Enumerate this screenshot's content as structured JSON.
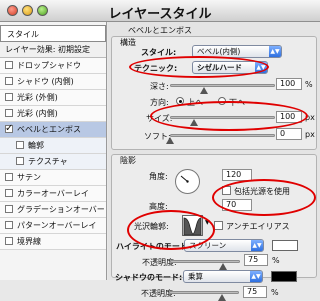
{
  "window": {
    "title": "レイヤースタイル"
  },
  "left_panel": {
    "header": "スタイル",
    "blend_options": "レイヤー効果: 初期設定",
    "items": [
      {
        "label": "ドロップシャドウ",
        "checked": false
      },
      {
        "label": "シャドウ (内側)",
        "checked": false
      },
      {
        "label": "光彩 (外側)",
        "checked": false
      },
      {
        "label": "光彩 (内側)",
        "checked": false
      },
      {
        "label": "ベベルとエンボス",
        "checked": true,
        "selected": true
      },
      {
        "label": "輪郭",
        "checked": false,
        "sub": true
      },
      {
        "label": "テクスチャ",
        "checked": false,
        "sub": true
      },
      {
        "label": "サテン",
        "checked": false
      },
      {
        "label": "カラーオーバーレイ",
        "checked": false
      },
      {
        "label": "グラデーションオーバーレイ",
        "checked": false
      },
      {
        "label": "パターンオーバーレイ",
        "checked": false
      },
      {
        "label": "境界線",
        "checked": false
      }
    ]
  },
  "bevel_emboss": {
    "group_title": "ベベルとエンボス",
    "structure_title": "構造",
    "style_label": "スタイル:",
    "style_value": "ベベル(内側)",
    "technique_label": "テクニック:",
    "technique_value": "シゼルハード",
    "depth_label": "深さ:",
    "depth_value": "100",
    "direction_label": "方向:",
    "direction_up": "上へ",
    "direction_down": "下へ",
    "size_label": "サイズ:",
    "size_value": "100",
    "size_unit": "px",
    "soften_label": "ソフト:",
    "soften_value": "0",
    "soften_unit": "px",
    "percent_unit": "%"
  },
  "shading": {
    "title": "陰影",
    "angle_label": "角度:",
    "angle_value": "120",
    "use_global_light": "包括光源を使用",
    "altitude_label": "高度:",
    "altitude_value": "70",
    "gloss_contour_label": "光沢輪郭:",
    "anti_aliased": "アンチエイリアス",
    "highlight_mode_label": "ハイライトのモード:",
    "highlight_mode_value": "スクリーン",
    "highlight_opacity_label": "不透明度:",
    "highlight_opacity_value": "75",
    "highlight_color": "#ffffff",
    "shadow_mode_label": "シャドウのモード:",
    "shadow_mode_value": "乗算",
    "shadow_opacity_label": "不透明度:",
    "shadow_opacity_value": "75",
    "shadow_color": "#000000",
    "percent_unit": "%"
  },
  "colors": {
    "highlight_ellipse": "#e00000",
    "selected_row": "#b8c8e4",
    "popup_arrow": "#2d6fe0"
  }
}
